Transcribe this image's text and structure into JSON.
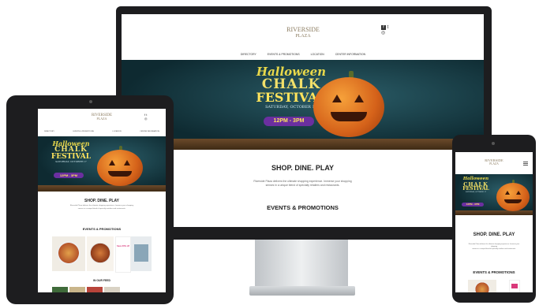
{
  "brand": {
    "name_line1": "RIVERSIDE",
    "name_line2": "PLAZA"
  },
  "nav": {
    "items": [
      "DIRECTORY",
      "EVENTS & PROMOTIONS",
      "LOCATION",
      "CENTER INFORMATION"
    ]
  },
  "social": {
    "facebook": "f",
    "twitter": "t",
    "instagram": "◎"
  },
  "hero": {
    "title_line1": "Halloween",
    "title_line2": "CHALK",
    "title_line3": "FESTIVAL",
    "date": "SATURDAY, OCTOBER 17",
    "time": "12PM - 3PM"
  },
  "content": {
    "tagline": "SHOP. DINE. PLAY",
    "intro_line1": "Riverside Plaza delivers the ultimate shopping experience. Immerse your shopping",
    "intro_line2": "senses in a unique blend of specialty retailers and restaurants.",
    "events_heading": "EVENTS & PROMOTIONS",
    "feed_heading": "IN OUR FEED",
    "promo_text": "Save 20% off"
  },
  "colors": {
    "device_frame": "#1d1d1f",
    "brand_gold": "#8a7a5e",
    "hero_teal": "#1b4750",
    "pumpkin_orange": "#e07a22",
    "time_purple": "#6b2fa0",
    "promo_pink": "#d9387a"
  },
  "icons": [
    "facebook-icon",
    "twitter-icon",
    "instagram-icon",
    "menu-icon",
    "camera-icon"
  ]
}
